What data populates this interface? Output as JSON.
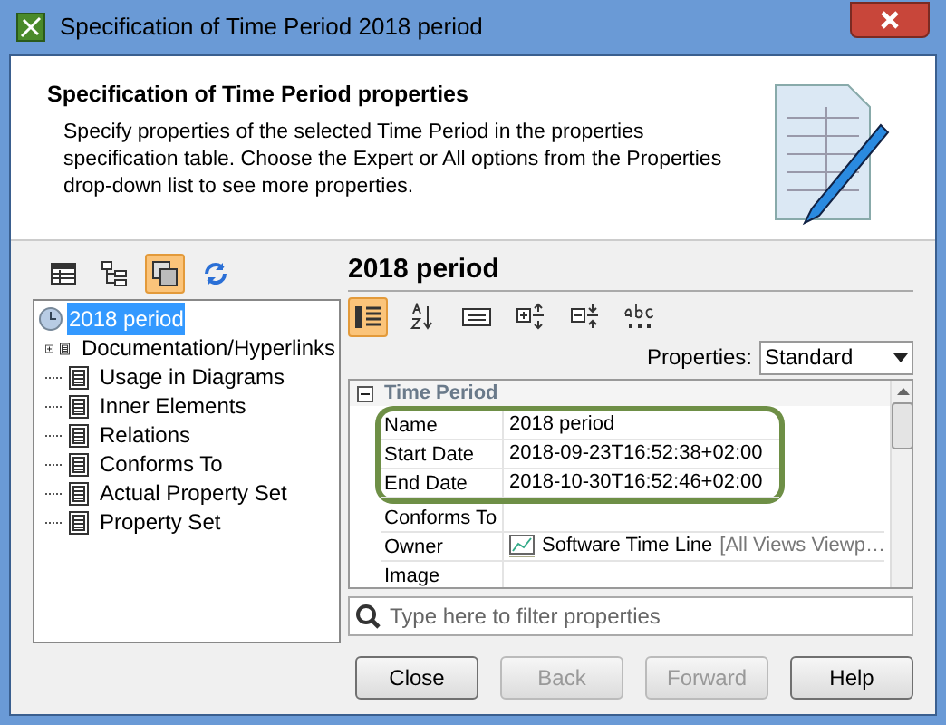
{
  "window": {
    "title": "Specification of Time Period 2018 period"
  },
  "header": {
    "title": "Specification of Time Period properties",
    "description": "Specify properties of the selected Time Period in the properties specification table. Choose the Expert or All options from the Properties drop-down list to see more properties."
  },
  "left_toolbar": [
    {
      "kind": "table",
      "selected": false
    },
    {
      "kind": "tree",
      "selected": false
    },
    {
      "kind": "windows",
      "selected": true
    },
    {
      "kind": "refresh",
      "selected": false
    }
  ],
  "tree": {
    "label": "2018 period",
    "selected": true,
    "children": [
      {
        "label": "Documentation/Hyperlinks",
        "expandable": true,
        "selected": false
      },
      {
        "label": "Usage in Diagrams",
        "expandable": false,
        "selected": false
      },
      {
        "label": "Inner Elements",
        "expandable": false,
        "selected": false
      },
      {
        "label": "Relations",
        "expandable": false,
        "selected": false
      },
      {
        "label": "Conforms To",
        "expandable": false,
        "selected": false
      },
      {
        "label": "Actual Property Set",
        "expandable": false,
        "selected": false
      },
      {
        "label": "Property Set",
        "expandable": false,
        "selected": false
      }
    ]
  },
  "panel_title": "2018 period",
  "right_toolbar": [
    {
      "kind": "grid",
      "selected": true
    },
    {
      "kind": "sort",
      "selected": false
    },
    {
      "kind": "field",
      "selected": false
    },
    {
      "kind": "expand",
      "selected": false
    },
    {
      "kind": "collapse",
      "selected": false
    },
    {
      "kind": "abc",
      "selected": false
    }
  ],
  "properties_filter": {
    "label": "Properties:",
    "value": "Standard"
  },
  "property_table": {
    "group": "Time Period",
    "expanded": true,
    "rows": [
      {
        "name": "Name",
        "value": "2018 period",
        "highlighted": true
      },
      {
        "name": "Start Date",
        "value": "2018-09-23T16:52:38+02:00",
        "highlighted": true
      },
      {
        "name": "End Date",
        "value": "2018-10-30T16:52:46+02:00",
        "highlighted": true
      },
      {
        "name": "Conforms To",
        "value": "",
        "highlighted": false
      },
      {
        "name": "Owner",
        "value": "Software Time Line",
        "extra": "[All Views Viewp…",
        "kind": "element",
        "highlighted": false
      },
      {
        "name": "Image",
        "value": "",
        "highlighted": false
      }
    ]
  },
  "search": {
    "placeholder": "Type here to filter properties"
  },
  "buttons": [
    {
      "label": "Close",
      "disabled": false
    },
    {
      "label": "Back",
      "disabled": true
    },
    {
      "label": "Forward",
      "disabled": true
    },
    {
      "label": "Help",
      "disabled": false
    }
  ]
}
